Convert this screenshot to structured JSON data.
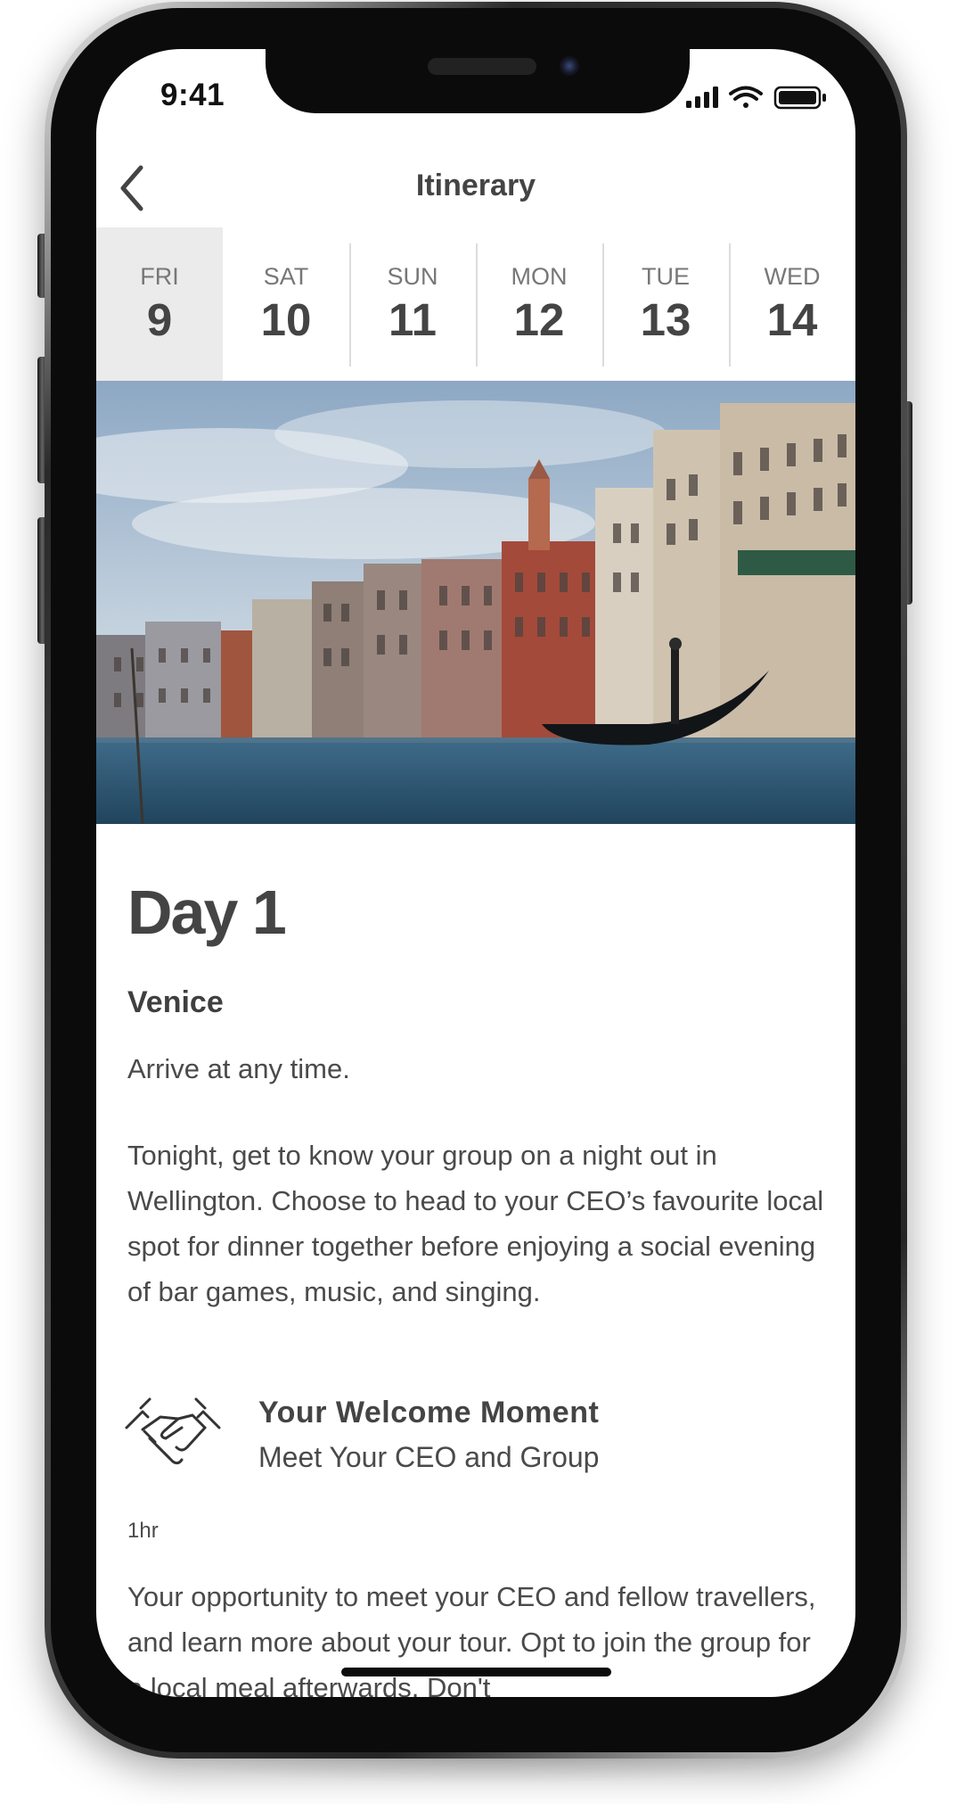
{
  "status_bar": {
    "time": "9:41"
  },
  "header": {
    "title": "Itinerary",
    "back_icon": "chevron-left-icon"
  },
  "day_tabs": [
    {
      "day": "FRI",
      "date": "9",
      "selected": true
    },
    {
      "day": "SAT",
      "date": "10",
      "selected": false
    },
    {
      "day": "SUN",
      "date": "11",
      "selected": false
    },
    {
      "day": "MON",
      "date": "12",
      "selected": false
    },
    {
      "day": "TUE",
      "date": "13",
      "selected": false
    },
    {
      "day": "WED",
      "date": "14",
      "selected": false
    }
  ],
  "content": {
    "day_title": "Day 1",
    "location": "Venice",
    "arrival_text": "Arrive at any time.",
    "description": "Tonight, get to know your group on a night out in Wellington. Choose to head to your CEO’s favourite local spot for dinner together before enjoying a social evening of bar games, music, and singing.",
    "moment": {
      "icon": "handshake-icon",
      "title": "Your Welcome Moment",
      "subtitle": "Meet Your CEO and Group",
      "duration": "1hr",
      "description": "Your opportunity to meet your CEO and fellow travellers, and learn more about your tour. Opt to join the group for a local meal afterwards. Don't"
    }
  },
  "colors": {
    "selected_tab_bg": "#ebebeb",
    "text_dark": "#444444",
    "text_body": "#4a4a4a",
    "divider": "#dcdcdc"
  }
}
